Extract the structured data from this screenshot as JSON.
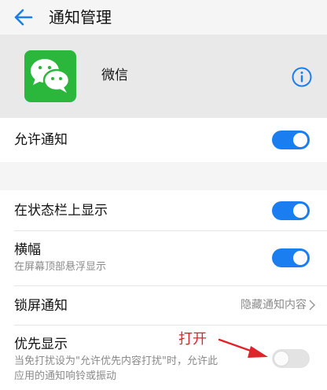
{
  "header": {
    "title": "通知管理",
    "back_icon": "back-arrow-icon"
  },
  "app": {
    "name": "微信",
    "icon": "wechat-logo",
    "info_icon": "info-icon",
    "icon_color": "#2bb63c"
  },
  "settings": {
    "allow_notifications": {
      "label": "允许通知",
      "enabled": true
    },
    "status_bar": {
      "label": "在状态栏上显示",
      "enabled": true
    },
    "banner": {
      "label": "横幅",
      "sublabel": "在屏幕顶部悬浮显示",
      "enabled": true
    },
    "lock_screen": {
      "label": "锁屏通知",
      "value": "隐藏通知内容"
    },
    "priority": {
      "label": "优先显示",
      "sublabel_line1": "当免打扰设为\"允许优先内容打扰\"时，允许此",
      "sublabel_line2": "应用的通知响铃或振动",
      "enabled": false
    }
  },
  "annotation": {
    "text": "打开",
    "color": "#e0232a"
  },
  "colors": {
    "toggle_on": "#1a7ef0",
    "toggle_off": "#e3e3e3",
    "accent": "#1a7ef0"
  }
}
